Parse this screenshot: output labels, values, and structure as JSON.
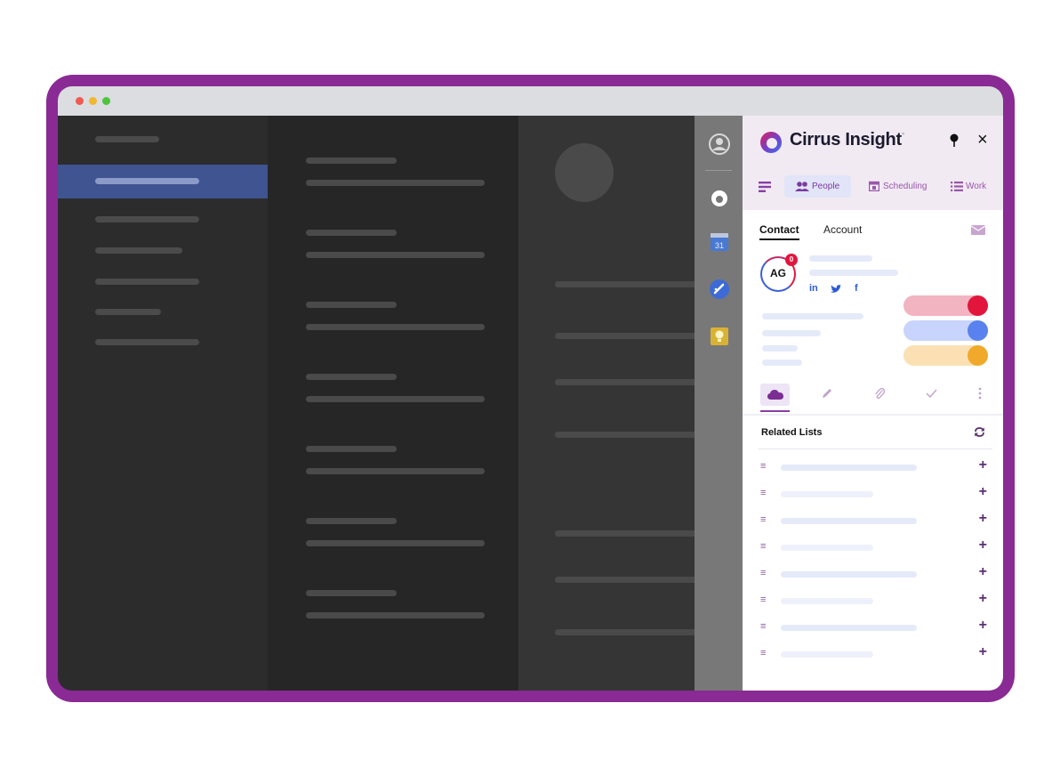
{
  "panel": {
    "brand": "Cirrus Insight",
    "brand_mark": "°",
    "pin_icon": "pin-icon",
    "close_label": "×",
    "nav_tabs": [
      {
        "label": "People",
        "icon": "people-icon",
        "active": true
      },
      {
        "label": "Scheduling",
        "icon": "calendar-icon",
        "active": false
      },
      {
        "label": "Work",
        "icon": "list-icon",
        "active": false
      }
    ],
    "record_tabs": [
      "Contact",
      "Account"
    ],
    "contact": {
      "initials": "AG",
      "badge_count": "0",
      "social": [
        "in",
        "f"
      ]
    },
    "toggle_colors": [
      "#e2163d",
      "#5a82ee",
      "#f0a92b"
    ],
    "related_lists": {
      "title": "Related Lists",
      "add_label": "+",
      "rows": 8
    }
  },
  "colors": {
    "frame": "#8a2a94",
    "accent_purple": "#8a3fa5",
    "selected_row": "#3f5490"
  }
}
